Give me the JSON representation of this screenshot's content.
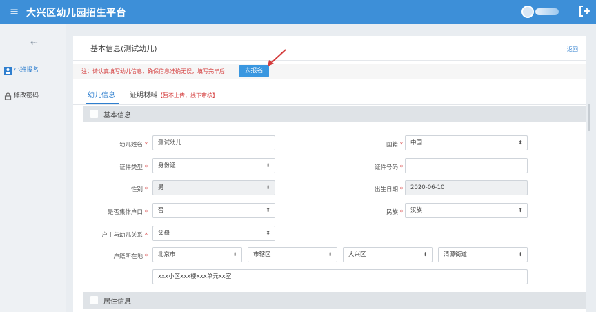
{
  "header": {
    "title": "大兴区幼儿园招生平台",
    "menu_icon": "≡"
  },
  "sidebar": {
    "items": [
      {
        "label": "小班报名",
        "active": true
      },
      {
        "label": "修改密码",
        "active": false
      }
    ]
  },
  "main": {
    "breadcrumb": "基本信息(测试幼儿)",
    "back_label": "返回",
    "notice": "注：请认真填写幼儿信息，确保信息准确无误，填写完毕后",
    "register_button": "去报名",
    "tabs": [
      {
        "label": "幼儿信息"
      },
      {
        "label": "证明材料",
        "note": "【暂不上传，线下审核】"
      }
    ],
    "section_basic": "基本信息",
    "section_residence": "居住信息"
  },
  "form": {
    "name": {
      "label": "幼儿姓名",
      "value": "测试幼儿"
    },
    "nationality": {
      "label": "国籍",
      "value": "中国"
    },
    "id_type": {
      "label": "证件类型",
      "value": "身份证"
    },
    "id_number": {
      "label": "证件号码",
      "value": ""
    },
    "gender": {
      "label": "性别",
      "value": "男"
    },
    "birth_date": {
      "label": "出生日期",
      "value": "2020-06-10"
    },
    "collective_hukou": {
      "label": "是否集体户口",
      "value": "否"
    },
    "ethnicity": {
      "label": "民族",
      "value": "汉族"
    },
    "relation": {
      "label": "户主与幼儿关系",
      "value": "父母"
    },
    "hukou_location": {
      "label": "户籍所在地",
      "city": "北京市",
      "district_type": "市辖区",
      "district": "大兴区",
      "street": "清源街道"
    },
    "address": {
      "value": "xxx小区xxx楼xxx单元xx室"
    }
  },
  "colors": {
    "topbar": "#3d8fd8",
    "accent": "#2f7fcf",
    "required": "#d43c3c"
  }
}
